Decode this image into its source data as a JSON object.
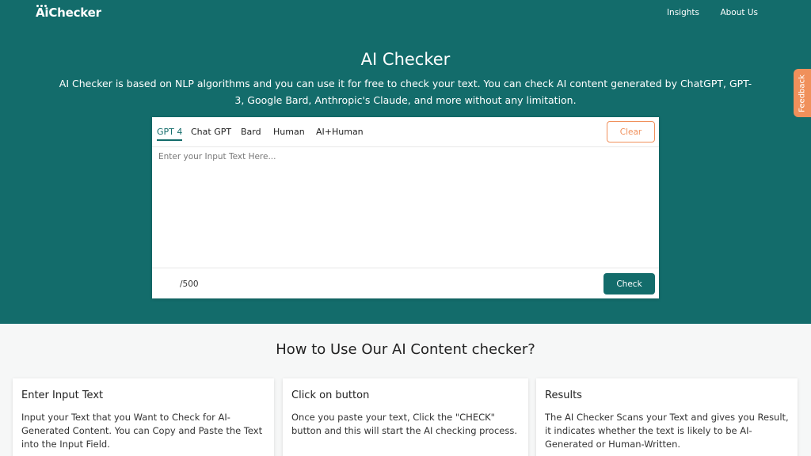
{
  "header": {
    "logo_prefix": "Ai",
    "logo_suffix": "Checker",
    "nav": [
      {
        "label": "Insights"
      },
      {
        "label": "About Us"
      }
    ]
  },
  "hero": {
    "title": "AI Checker",
    "description": "AI Checker is based on NLP algorithms and you can use it for free to check your text. You can check AI content generated by ChatGPT, GPT-3, Google Bard, Anthropic's Claude, and more without any limitation."
  },
  "feedback": {
    "label": "Feedback"
  },
  "checker": {
    "tabs": [
      {
        "label": "GPT 4",
        "active": true
      },
      {
        "label": "Chat GPT"
      },
      {
        "label": "Bard"
      },
      {
        "label": "Human"
      },
      {
        "label": "AI+Human"
      }
    ],
    "clear_label": "Clear",
    "input_placeholder": "Enter your Input Text Here...",
    "input_value": "",
    "counter": "/500",
    "check_label": "Check"
  },
  "how_to": {
    "title": "How to Use Our AI Content checker?",
    "cards": [
      {
        "title": "Enter Input Text",
        "text": "Input your Text that you Want to Check for AI-Generated Content. You can Copy and Paste the Text into the Input Field."
      },
      {
        "title": "Click on button",
        "text": "Once you paste your text, Click the \"CHECK\" button and this will start the AI checking process."
      },
      {
        "title": "Results",
        "text": "The AI Checker Scans your Text and gives you Result, it indicates whether the text is likely to be AI-Generated or Human-Written."
      }
    ]
  },
  "colors": {
    "primary": "#136c6b",
    "accent": "#f0905b",
    "background": "#f6f7f7"
  }
}
